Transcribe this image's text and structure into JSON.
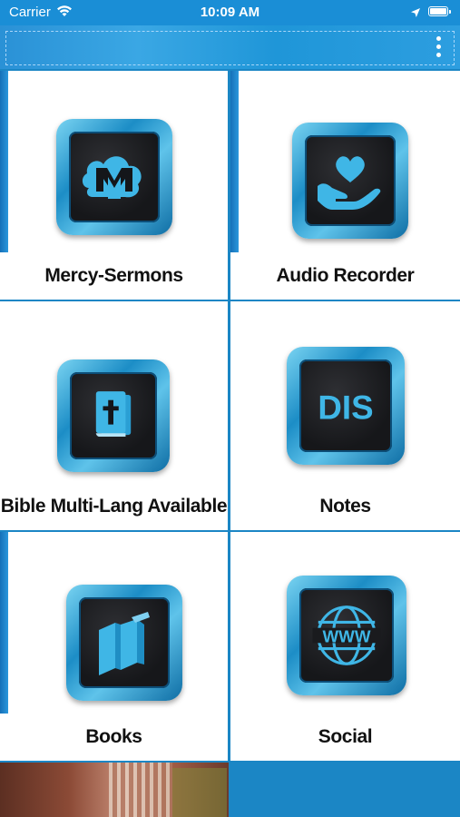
{
  "status_bar": {
    "carrier": "Carrier",
    "time": "10:09 AM"
  },
  "toolbar": {
    "menu_icon": "more-vertical-icon"
  },
  "tiles": [
    {
      "label": "Mercy-Sermons",
      "icon": "mercy-sermons-logo-icon"
    },
    {
      "label": "Audio Recorder",
      "icon": "heart-in-hand-icon"
    },
    {
      "label": "Bible Multi-Lang Available",
      "icon": "bible-cross-icon"
    },
    {
      "label": "Notes",
      "icon": "dis-text-icon"
    },
    {
      "label": "Books",
      "icon": "books-icon"
    },
    {
      "label": "Social",
      "icon": "www-globe-icon"
    }
  ],
  "colors": {
    "accent": "#1b86c5",
    "status_bar": "#1a8ed6",
    "icon_blue": "#3fb6e6",
    "icon_dark": "#1a1b1e"
  }
}
